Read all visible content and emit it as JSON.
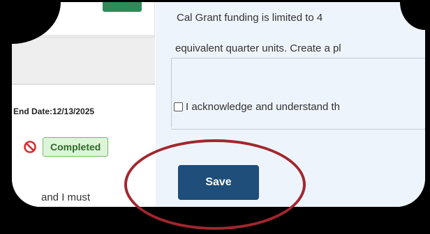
{
  "left": {
    "end_date": "End Date:12/13/2025",
    "status_badge": "Completed",
    "status_icon": "prohibit-icon",
    "body_fragment": "and I must"
  },
  "right": {
    "line1": "Cal Grant funding is limited to 4",
    "line2": "equivalent quarter units. Create a pl",
    "acknowledge_label": "I acknowledge and understand th",
    "acknowledge_checked": false
  },
  "actions": {
    "save_label": "Save"
  },
  "colors": {
    "save_button": "#1e4e79",
    "badge_bg": "#dff3dc",
    "badge_border": "#6cbf5e",
    "highlight": "#a3262e",
    "prohibit": "#d32f2f"
  }
}
